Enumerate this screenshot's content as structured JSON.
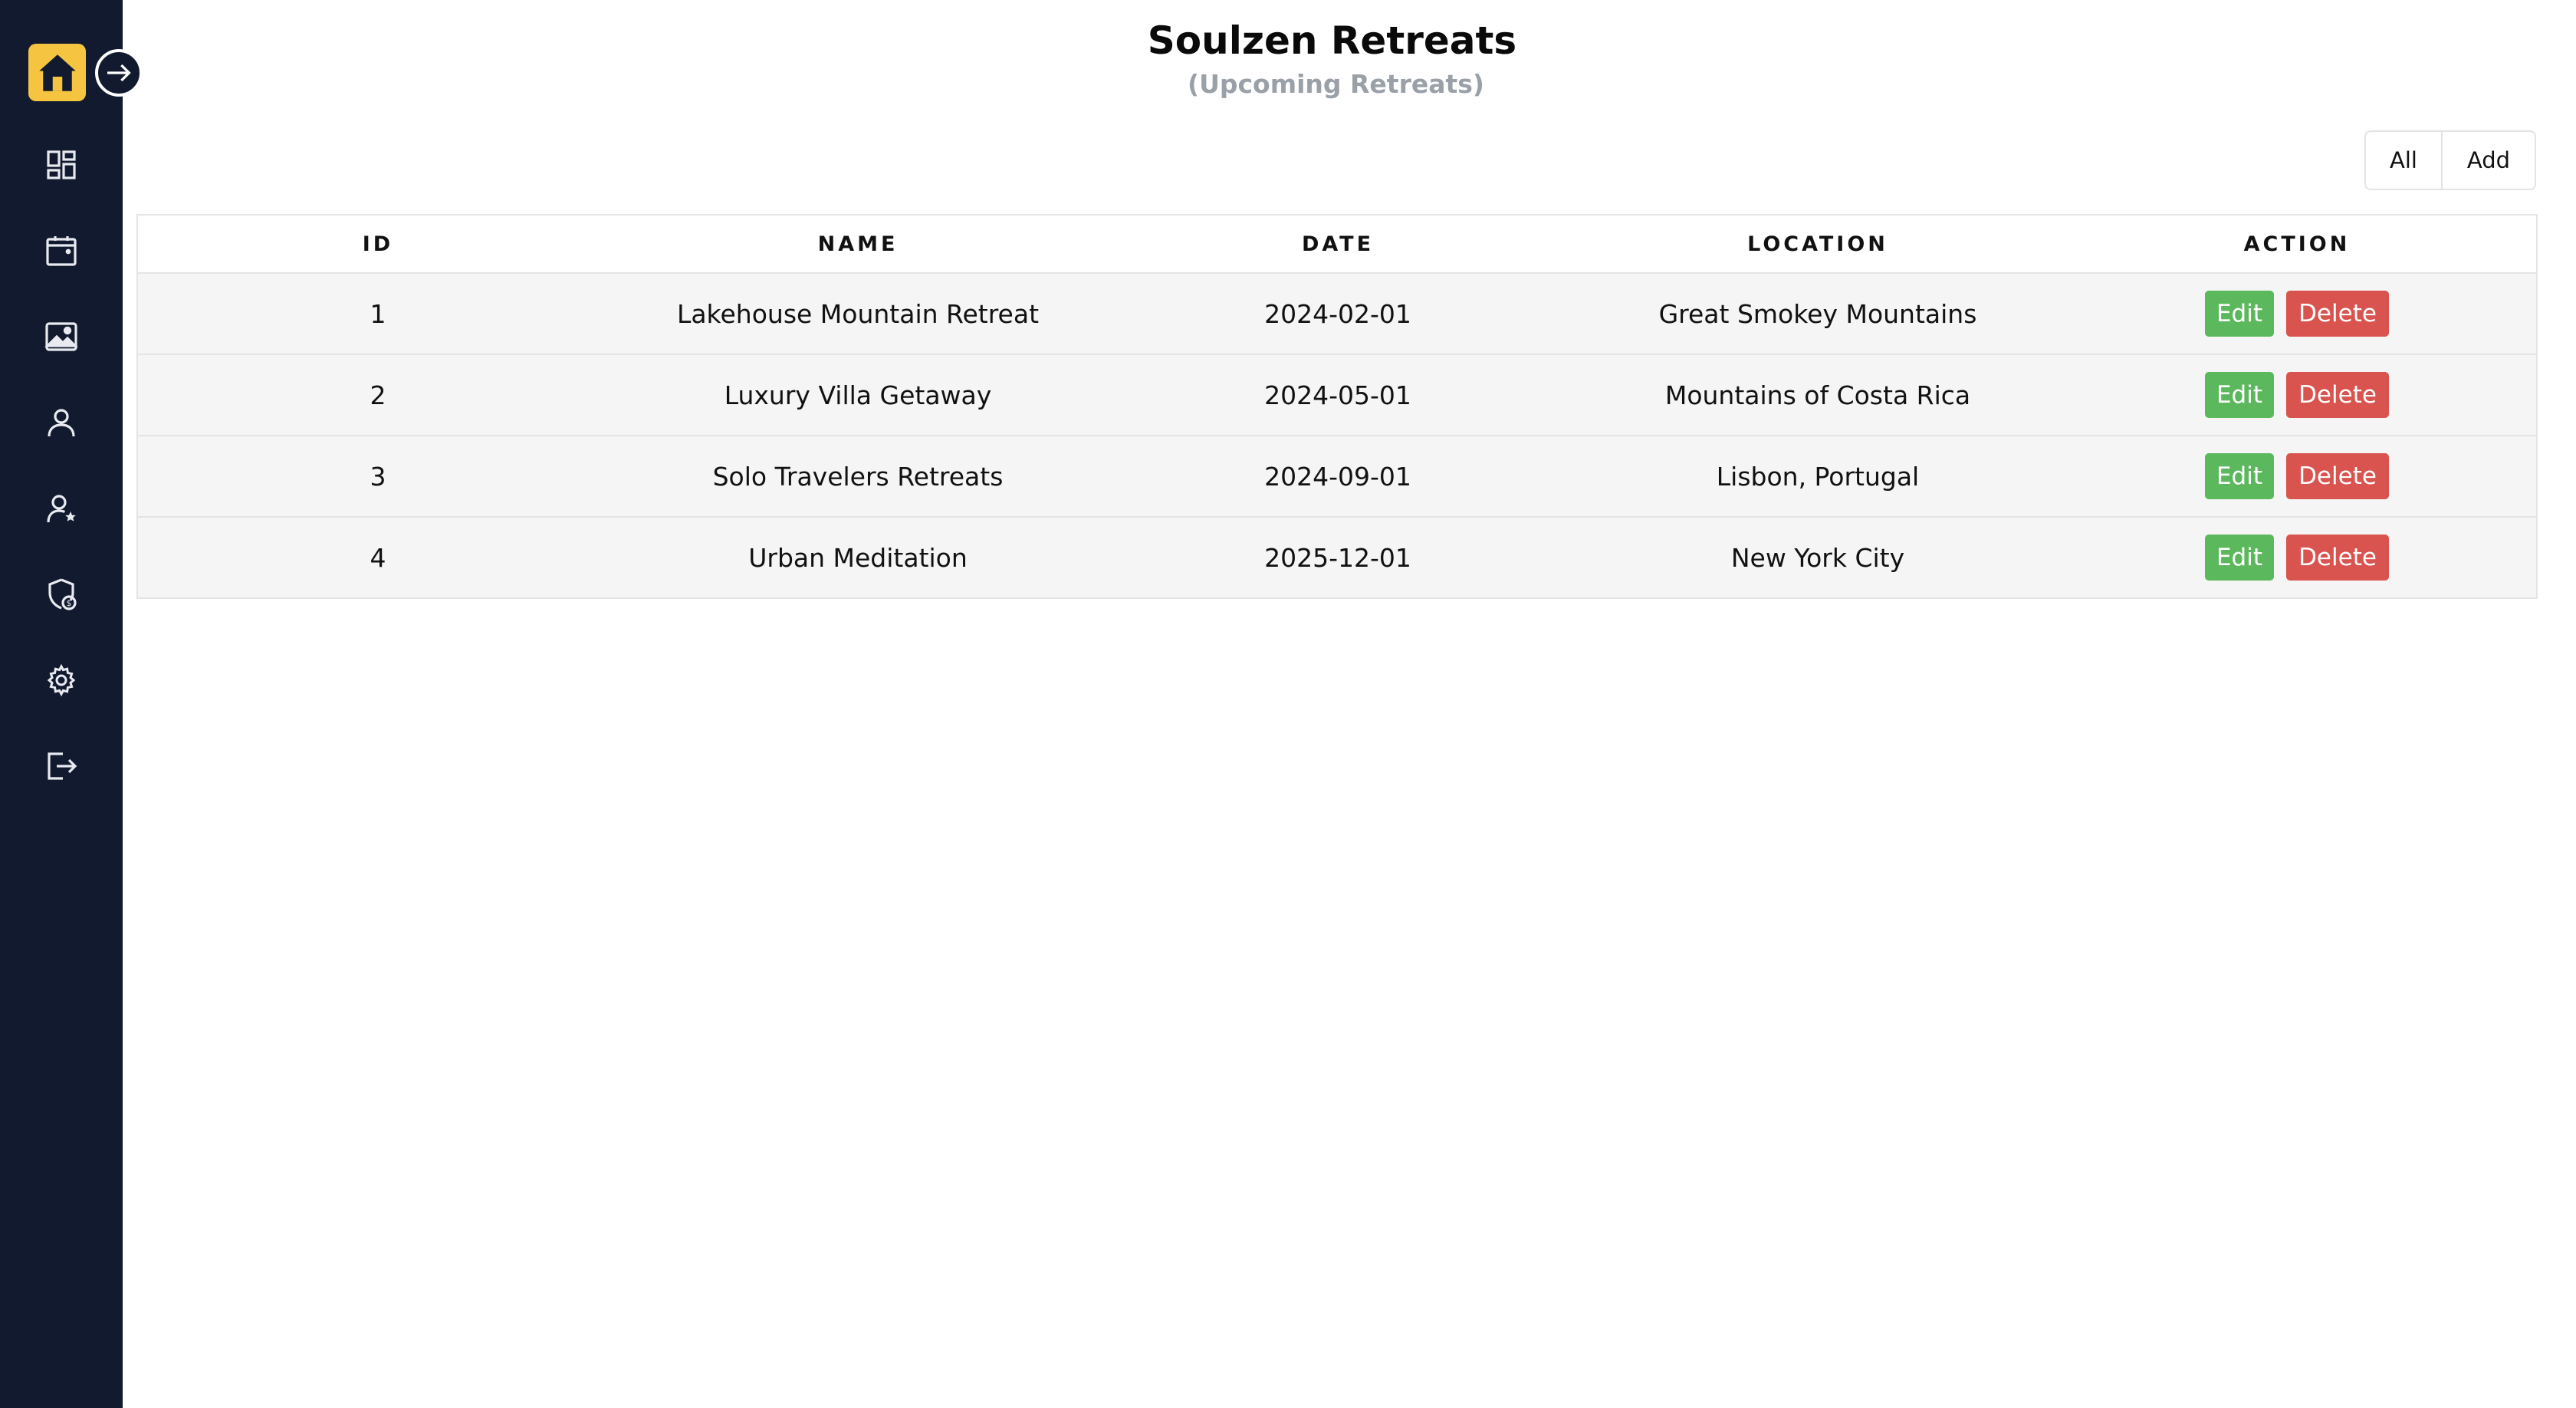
{
  "colors": {
    "sidebar_bg": "#111a2e",
    "logo_bg": "#f5c542",
    "edit": "#5cb85c",
    "delete": "#d9534f",
    "subtitle": "#9aa0a8"
  },
  "sidebar": {
    "logo_icon": "home-icon",
    "expand_icon": "arrow-right-circle-icon",
    "items": [
      {
        "icon": "dashboard-icon"
      },
      {
        "icon": "calendar-icon"
      },
      {
        "icon": "image-icon"
      },
      {
        "icon": "user-icon"
      },
      {
        "icon": "user-star-icon"
      },
      {
        "icon": "shield-dollar-icon"
      },
      {
        "icon": "gear-icon"
      },
      {
        "icon": "logout-icon"
      }
    ]
  },
  "header": {
    "title": "Soulzen Retreats",
    "subtitle": "(Upcoming Retreats)"
  },
  "toolbar": {
    "all_label": "All",
    "add_label": "Add"
  },
  "table": {
    "columns": [
      "ID",
      "NAME",
      "DATE",
      "LOCATION",
      "ACTION"
    ],
    "rows": [
      {
        "id": "1",
        "name": "Lakehouse Mountain Retreat",
        "date": "2024-02-01",
        "location": "Great Smokey Mountains",
        "edit": "Edit",
        "delete": "Delete"
      },
      {
        "id": "2",
        "name": "Luxury Villa Getaway",
        "date": "2024-05-01",
        "location": "Mountains of Costa Rica",
        "edit": "Edit",
        "delete": "Delete"
      },
      {
        "id": "3",
        "name": "Solo Travelers Retreats",
        "date": "2024-09-01",
        "location": "Lisbon, Portugal",
        "edit": "Edit",
        "delete": "Delete"
      },
      {
        "id": "4",
        "name": "Urban Meditation",
        "date": "2025-12-01",
        "location": "New York City",
        "edit": "Edit",
        "delete": "Delete"
      }
    ]
  }
}
